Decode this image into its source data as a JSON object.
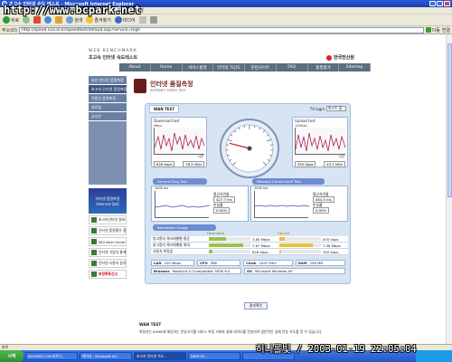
{
  "window": {
    "title": "초고속 인터넷 속도 테스트 - Microsoft Internet Explorer",
    "watermark_url": "http://www.bcpark.net"
  },
  "menu": [
    "파일",
    "편집",
    "보기",
    "즐겨찾기",
    "도구",
    "도움말"
  ],
  "toolbar": {
    "back": "뒤로",
    "search": "검색",
    "favorites": "즐겨찾기",
    "media": "미디어"
  },
  "address": {
    "label": "주소(D)",
    "value": "http://speed.nca.or.kr/speedtest/default.asp?service=high",
    "go": "이동",
    "links": "연결"
  },
  "site": {
    "logo_en": "WEB BENCHMARK",
    "logo_kr": "초고속 인터넷 속도테스트",
    "kt": "한국전산원",
    "nav": [
      "About",
      "Home",
      "서비스품질",
      "인터넷 가상도",
      "관련사이트",
      "FAQ",
      "품질평가",
      "Sitemap"
    ]
  },
  "sidebar": {
    "items": [
      "유선 인터넷 품질측정",
      "초고속 인터넷 품질측정",
      "전용선 품질측정",
      "자료실",
      "공지란"
    ],
    "banner": "이지넷 품질측정 Internet QoS",
    "links": [
      "초고속인터넷 정보센터",
      "인터넷 품질평가 결과",
      "NGI Next Generation Internet",
      "인터넷 가입자 통계정보",
      "인터넷 사용자 동의서",
      "부정루트신고"
    ]
  },
  "page": {
    "title_kr": "인터넷 품질측정",
    "title_en": "INTERNET SPEED TEST",
    "tab": "WAN TEST",
    "tv_login_label": "TV login",
    "tv_login_value": "마스트 클",
    "download": {
      "title": "Download test",
      "unit": "Mbps",
      "speed": "628 kbps",
      "loss": "78.5 kB/s",
      "time_label": "시간"
    },
    "upload": {
      "title": "Upload test",
      "unit": "10Mbps",
      "speed": "350 kbps",
      "loss": "43.7 kB/s",
      "time_label": "시간"
    },
    "gauge_value": 0.22,
    "general_ping": {
      "title": "General Ping Test",
      "ms": "1000 ms",
      "avg_label": "평균지연율",
      "avg": "427.7 ms",
      "loss_label": "손실률",
      "loss": "0.00%",
      "time_label": "시간"
    },
    "network_ping": {
      "title": "Network Control VoIP Test",
      "ms": "1000 ms",
      "avg_label": "평균지연율",
      "avg": "464.5 ms",
      "loss_label": "손실률",
      "loss": "0.00%",
      "time_label": "시간"
    },
    "bandwidth_title": "Bandwidth Gauge",
    "bw_headers": {
      "download": "Download",
      "upload": "Upload"
    },
    "bw_rows": [
      {
        "label": "방고용지 체크레벨별 평균",
        "down": "3.85 Mbps",
        "down_fill": 0.42,
        "up": "835 kbps",
        "up_fill": 0.12
      },
      {
        "label": "방고용지 체크레벨별 최대",
        "down": "7.67 Mbps",
        "down_fill": 0.82,
        "up": "7.58 Mbps",
        "up_fill": 0.8
      },
      {
        "label": "사용자 측정값",
        "down": "628 kbps",
        "down_fill": 0.08,
        "up": "350 kbps",
        "up_fill": 0.05
      }
    ],
    "env": {
      "lan_label": "LAN",
      "lan": "100 Mbps",
      "cpu_label": "CPU",
      "cpu": "586",
      "clock_label": "Clock",
      "clock": "2497 MHz",
      "ram_label": "RAM",
      "ram": "256 MB",
      "browser_label": "Browser",
      "browser": "Mozilla/4.0 (Compatible; MSIE 6.0",
      "os_label": "OS",
      "os": "Microsoft Windows XP"
    },
    "confirm": "결과확인",
    "desc_title": "WAN TEST",
    "desc_text": "측정자는 60MB에 해당하는 전송크기를 서비스 측정 서버와 실제 데이터를 전송하여 일반적인 실제 전송 속도를 알 수 있습니다."
  },
  "statusbar": {
    "text": "완료"
  },
  "taskbar": {
    "start": "시작",
    "items": [
      "SKYWEB.COM 파트너..",
      "페이지 - Microsoft Int..",
      "초고속 인터넷 속도..",
      "NBPC30 ..",
      "..."
    ],
    "watermark_time": "허나롤빛 / 2003-01-19 22:05:04"
  }
}
